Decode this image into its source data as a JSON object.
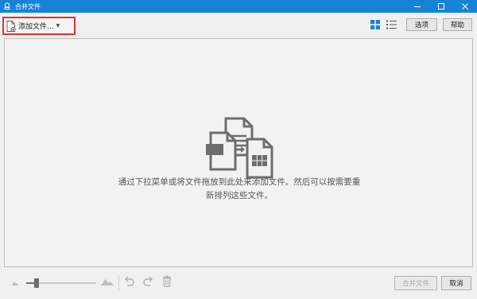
{
  "window": {
    "title": "合并文件"
  },
  "toolbar": {
    "add_files_label": "添加文件...",
    "options_label": "选项",
    "help_label": "帮助"
  },
  "drop_area": {
    "hint": "通过下拉菜单或将文件拖放到此处来添加文件。然后可以按需要重新排列这些文件。"
  },
  "bottom": {
    "thumbnail_size": 0.12,
    "merge_label": "合并文件",
    "cancel_label": "取消"
  },
  "colors": {
    "titlebar": "#1783d8",
    "highlight_border": "#d9352f",
    "grid_view_active": "#1783d8",
    "icon_gray": "#6d6d6d"
  },
  "icons": {
    "app": "stamp-icon",
    "add_files": "add-document-icon",
    "grid_view": "grid-view-icon",
    "list_view": "list-view-icon",
    "illustration": "multiple-files-icon",
    "small_thumbnail": "small-mountain-icon",
    "large_thumbnail": "large-mountain-icon",
    "undo": "undo-icon",
    "redo": "redo-icon",
    "delete": "trash-icon"
  }
}
